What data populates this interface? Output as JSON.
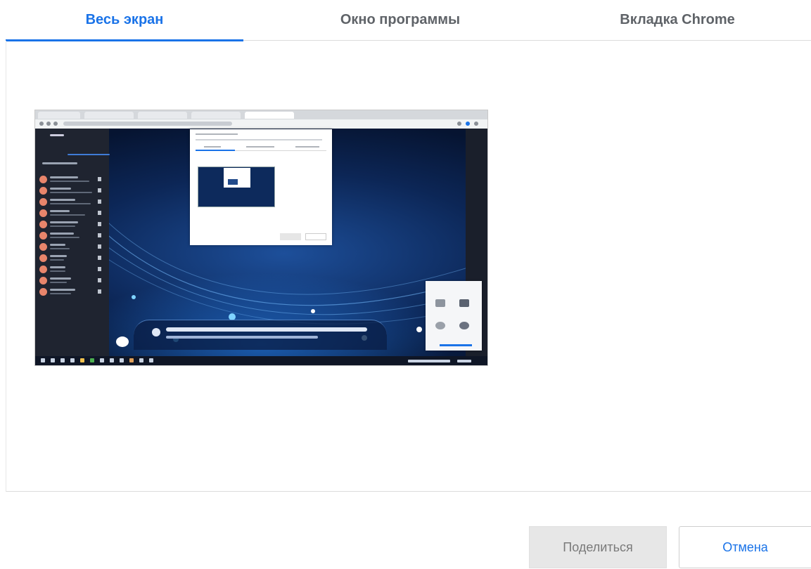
{
  "tabs": [
    {
      "label": "Весь экран",
      "selected": true
    },
    {
      "label": "Окно программы",
      "selected": false
    },
    {
      "label": "Вкладка Chrome",
      "selected": false
    }
  ],
  "buttons": {
    "share_label": "Поделиться",
    "cancel_label": "Отмена"
  },
  "colors": {
    "accent": "#1a73e8",
    "tab_inactive_text": "#5f6368",
    "share_button_bg": "#e7e7e7",
    "share_button_text": "#7a7a7a"
  }
}
